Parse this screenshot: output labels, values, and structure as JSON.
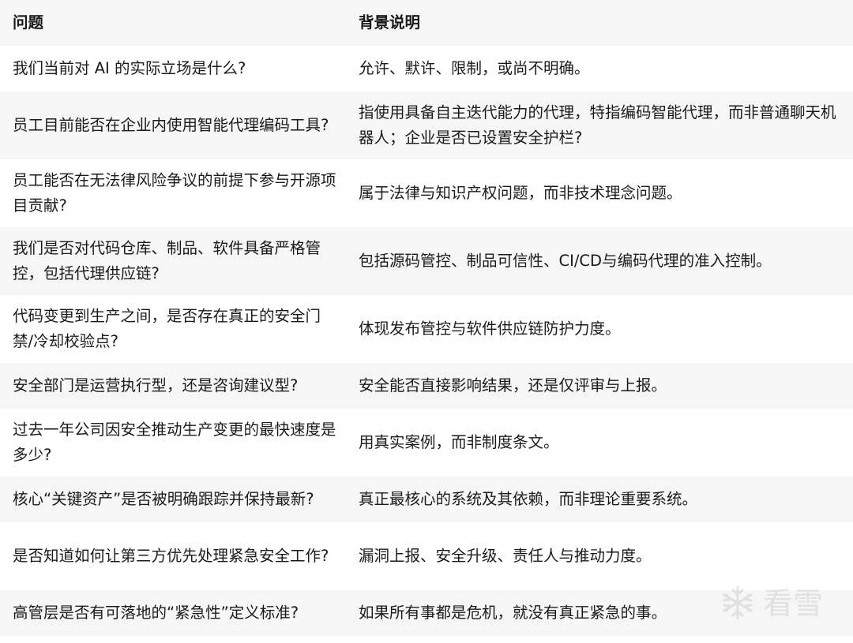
{
  "table": {
    "headers": [
      "问题",
      "背景说明"
    ],
    "rows": [
      [
        "我们当前对 AI 的实际立场是什么?",
        "允许、默许、限制，或尚不明确。"
      ],
      [
        "员工目前能否在企业内使用智能代理编码工具?",
        "指使用具备自主迭代能力的代理，特指编码智能代理，而非普通聊天机器人；企业是否已设置安全护栏?"
      ],
      [
        "员工能否在无法律风险争议的前提下参与开源项目贡献?",
        "属于法律与知识产权问题，而非技术理念问题。"
      ],
      [
        "我们是否对代码仓库、制品、软件具备严格管控，包括代理供应链?",
        "包括源码管控、制品可信性、CI/CD与编码代理的准入控制。"
      ],
      [
        "代码变更到生产之间，是否存在真正的安全门禁/冷却校验点?",
        "体现发布管控与软件供应链防护力度。"
      ],
      [
        "安全部门是运营执行型，还是咨询建议型?",
        "安全能否直接影响结果，还是仅评审与上报。"
      ],
      [
        "过去一年公司因安全推动生产变更的最快速度是多少?",
        "用真实案例，而非制度条文。"
      ],
      [
        "核心“关键资产”是否被明确跟踪并保持最新?",
        "真正最核心的系统及其依赖，而非理论重要系统。"
      ],
      [
        "是否知道如何让第三方优先处理紧急安全工作?",
        "漏洞上报、安全升级、责任人与推动力度。"
      ],
      [
        "高管层是否有可落地的“紧急性”定义标准?",
        "如果所有事都是危机，就没有真正紧急的事。"
      ]
    ]
  },
  "watermark": {
    "text": "看雪",
    "icon": "snowflake-icon"
  }
}
